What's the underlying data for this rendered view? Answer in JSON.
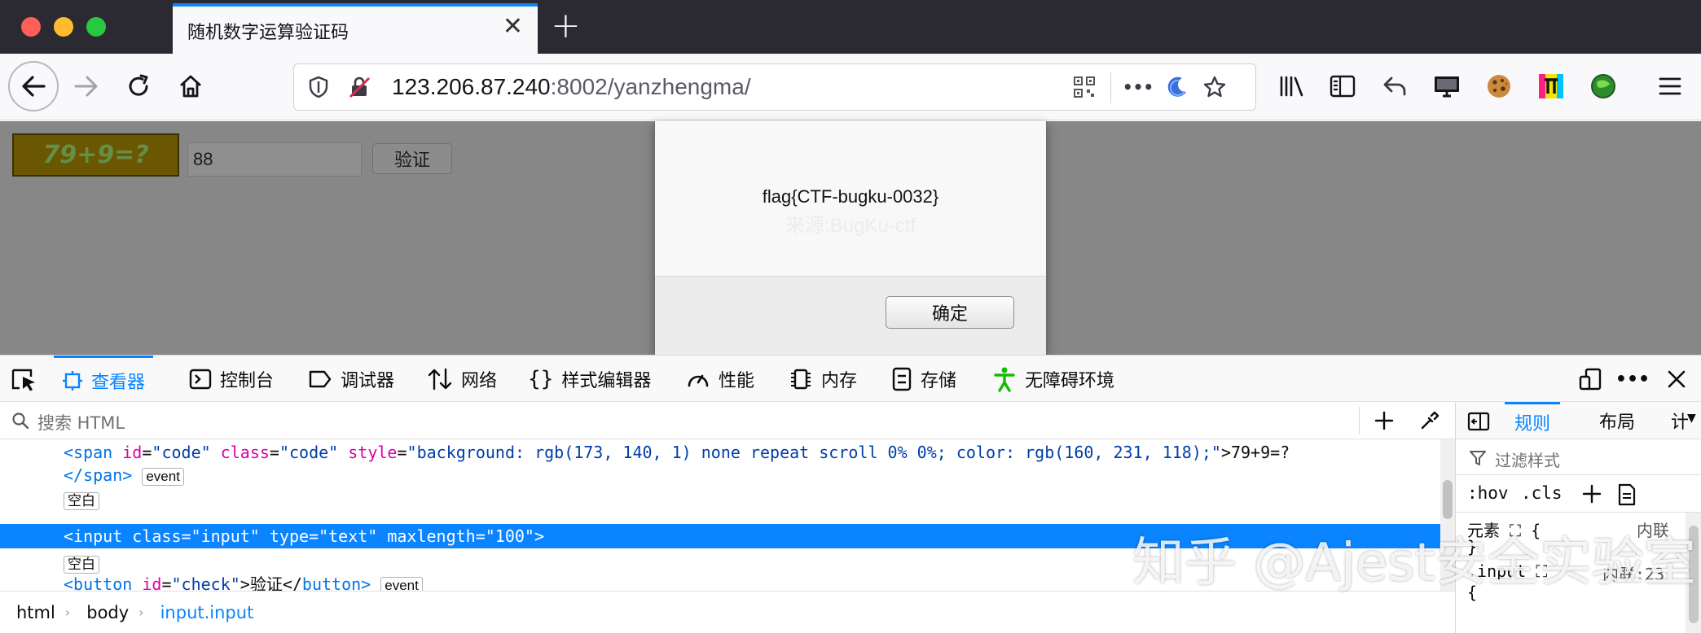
{
  "browser": {
    "tab_title": "随机数字运算验证码",
    "tab_close": "✕",
    "new_tab": "+",
    "url_host": "123.206.87.240",
    "url_path": ":8002/yanzhengma/",
    "url_more": "•••"
  },
  "page": {
    "captcha_text": "79+9=?",
    "captcha_bg": "#ad8c01",
    "captcha_color": "#a0e776",
    "answer_value": "88",
    "verify_label": "验证"
  },
  "dialog": {
    "message": "flag{CTF-bugku-0032}",
    "faint_text": "来源:BugKu-ctf",
    "ok_label": "确定"
  },
  "devtools": {
    "tabs": [
      {
        "label": "查看器",
        "icon": "inspector-icon"
      },
      {
        "label": "控制台",
        "icon": "console-icon"
      },
      {
        "label": "调试器",
        "icon": "debugger-icon"
      },
      {
        "label": "网络",
        "icon": "network-icon"
      },
      {
        "label": "样式编辑器",
        "icon": "style-editor-icon"
      },
      {
        "label": "性能",
        "icon": "performance-icon"
      },
      {
        "label": "内存",
        "icon": "memory-icon"
      },
      {
        "label": "存储",
        "icon": "storage-icon"
      },
      {
        "label": "无障碍环境",
        "icon": "accessibility-icon"
      }
    ],
    "search_placeholder": "搜索 HTML",
    "markup": {
      "line1": {
        "open": "<",
        "tag": "span",
        "a1": "id",
        "v1": "\"code\"",
        "a2": "class",
        "v2": "\"code\"",
        "a3": "style",
        "v3": "\"background: rgb(173, 140, 1) none repeat scroll 0% 0%; color: rgb(160, 231, 118);\"",
        "close": ">79+9=?"
      },
      "line2_close_tag": "</span>",
      "event_badge": "event",
      "whitespace_badge": "空白",
      "selected_line": "<input class=\"input\" type=\"text\" maxlength=\"100\">",
      "line_button": {
        "open": "<",
        "tag": "button",
        "a1": "id",
        "v1": "\"check\"",
        "text": ">验证</",
        "close_tag": "button",
        "end": ">"
      }
    },
    "breadcrumb": [
      "html",
      "body",
      "input.input"
    ],
    "sidebar": {
      "tabs": [
        "规则",
        "布局",
        "计"
      ],
      "filter_placeholder": "过滤样式",
      "hov": ":hov",
      "cls": ".cls",
      "rule_element": "元素 ⛶ {",
      "rule_element_src": "内联",
      "rule_element_close": "}",
      "rule_input": ".input ⛶",
      "rule_input_src": "内联:23",
      "rule_input_open": "{"
    }
  },
  "watermark": "知乎 @Ajest安全实验室",
  "colors": {
    "accent": "#0a84ff",
    "tag": "#0074e8",
    "attr": "#dd00a9",
    "value": "#003eaa"
  }
}
